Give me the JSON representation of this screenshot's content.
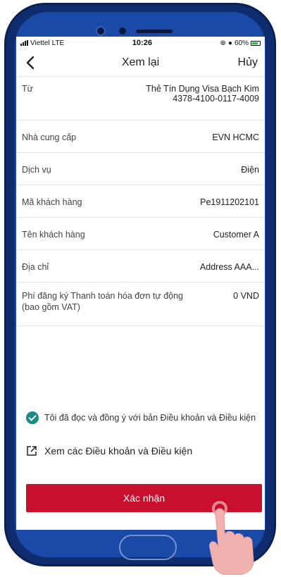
{
  "status_bar": {
    "carrier": "Viettel",
    "network": "LTE",
    "time": "10:26",
    "battery": "60%",
    "icons": [
      "signal-icon",
      "alarm-icon",
      "lock-icon",
      "battery-icon"
    ]
  },
  "nav": {
    "title": "Xem lại",
    "cancel_label": "Hủy",
    "back_icon": "chevron-left-icon"
  },
  "details": {
    "from_label": "Từ",
    "from_card_name": "Thẻ Tín Dụng Visa Bạch Kim",
    "from_card_number": "4378-4100-0117-4009",
    "provider_label": "Nhà cung cấp",
    "provider_value": "EVN HCMC",
    "service_label": "Dịch vụ",
    "service_value": "Điện",
    "customer_code_label": "Mã khách hàng",
    "customer_code_value": "Pe1911202101",
    "customer_name_label": "Tên khách hàng",
    "customer_name_value": "Customer A",
    "address_label": "Địa chỉ",
    "address_value": "Address AAA...",
    "fee_label": "Phí đăng ký Thanh toán hóa đơn tự động (bao gồm VAT)",
    "fee_value": "0 VND"
  },
  "agreement": {
    "checked": true,
    "text": "Tôi đã đọc và đồng ý với bản Điều khoản và Điều kiện"
  },
  "terms_link": {
    "label": "Xem các Điều khoản và Điều kiện",
    "icon": "external-link-icon"
  },
  "confirm_button": {
    "label": "Xác nhận"
  },
  "colors": {
    "accent": "#c8102e",
    "check": "#1a8a82",
    "phone_frame": "#0f2c6e",
    "phone_bezel": "#1a4aa8"
  }
}
